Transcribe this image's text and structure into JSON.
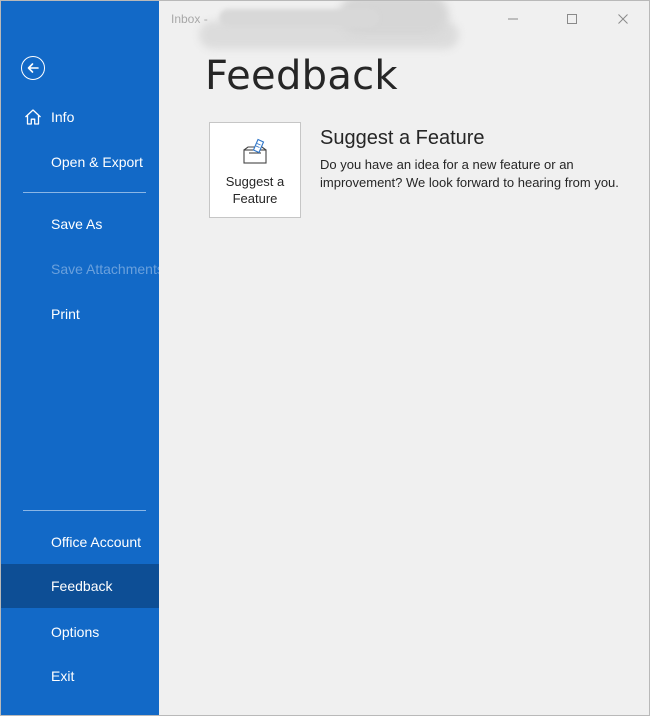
{
  "window": {
    "title_prefix": "Inbox -"
  },
  "sidebar": {
    "items": [
      {
        "label": "Info"
      },
      {
        "label": "Open & Export"
      },
      {
        "label": "Save As"
      },
      {
        "label": "Save Attachments"
      },
      {
        "label": "Print"
      },
      {
        "label": "Office Account"
      },
      {
        "label": "Feedback"
      },
      {
        "label": "Options"
      },
      {
        "label": "Exit"
      }
    ],
    "active": "Feedback",
    "color": "#1269c7",
    "active_color": "#0d4e95"
  },
  "main": {
    "title": "Feedback",
    "feature": {
      "tile_label": "Suggest a Feature",
      "heading": "Suggest a Feature",
      "description": "Do you have an idea for a new feature or an improvement? We look forward to hearing from you."
    }
  },
  "icons": {
    "back": "back-arrow-icon",
    "info": "home-icon",
    "tile": "suggestion-box-icon"
  }
}
